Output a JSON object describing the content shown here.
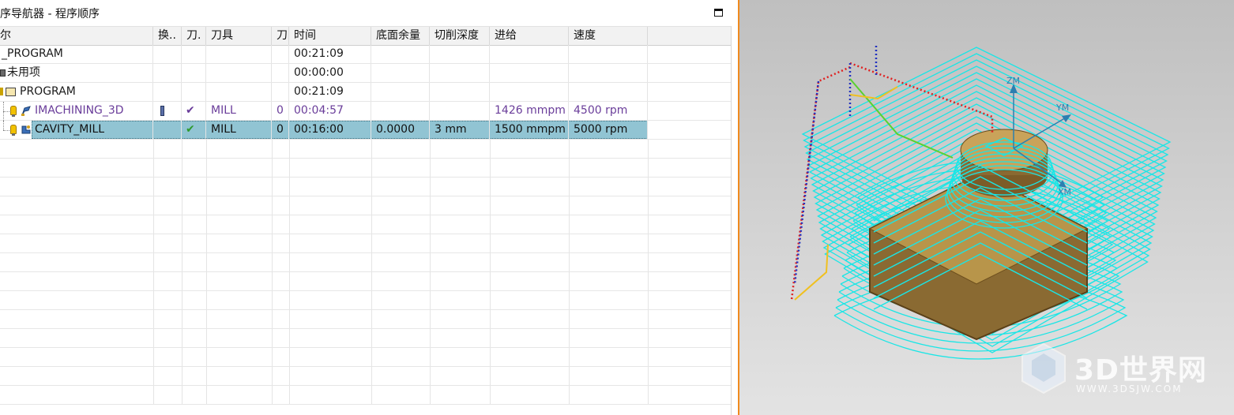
{
  "navigator": {
    "title": "序导航器 - 程序顺序",
    "columns": [
      "尔",
      "换..",
      "刀.",
      "刀具",
      "刀",
      "时间",
      "底面余量",
      "切削深度",
      "进给",
      "速度"
    ],
    "rows": [
      {
        "name": "_PROGRAM",
        "change": "",
        "path": "",
        "tool": "",
        "tool_no": "",
        "time": "00:21:09",
        "floor_stock": "",
        "cut_depth": "",
        "feed": "",
        "speed": ""
      },
      {
        "name": "未用项",
        "change": "",
        "path": "",
        "tool": "",
        "tool_no": "",
        "time": "00:00:00",
        "floor_stock": "",
        "cut_depth": "",
        "feed": "",
        "speed": ""
      },
      {
        "name": "PROGRAM",
        "change": "",
        "path": "",
        "tool": "",
        "tool_no": "",
        "time": "00:21:09",
        "floor_stock": "",
        "cut_depth": "",
        "feed": "",
        "speed": ""
      },
      {
        "name": "IMACHINING_3D",
        "change": "",
        "path": "✔",
        "tool": "MILL",
        "tool_no": "0",
        "time": "00:04:57",
        "floor_stock": "",
        "cut_depth": "",
        "feed": "1426 mmpm",
        "speed": "4500 rpm"
      },
      {
        "name": "CAVITY_MILL",
        "change": "",
        "path": "✔",
        "tool": "MILL",
        "tool_no": "0",
        "time": "00:16:00",
        "floor_stock": "0.0000",
        "cut_depth": "3 mm",
        "feed": "1500 mmpm",
        "speed": "5000 rpm"
      }
    ]
  },
  "viewport": {
    "axis_labels": {
      "z": "ZM",
      "y": "YM",
      "x": "XM"
    },
    "watermark": {
      "brand": "3D世界网",
      "url": "WWW.3DSJW.COM"
    },
    "colors": {
      "toolpath": "#19e6e6",
      "part": "#b8954a",
      "rapid": "#e02020",
      "engage": "#2030c0",
      "axis": "#2b7fb0",
      "accent_border": "#f08a1e"
    }
  }
}
